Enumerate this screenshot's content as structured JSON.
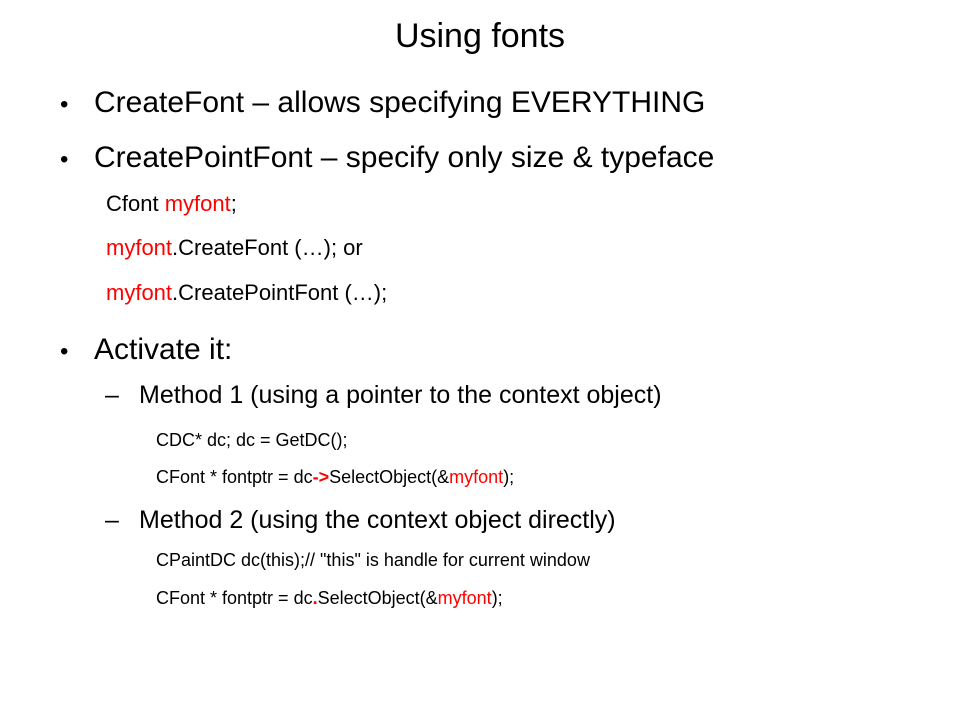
{
  "title": "Using fonts",
  "bullets": [
    {
      "label": "CreateFont – allows specifying EVERYTHING"
    },
    {
      "label": "CreatePointFont – specify only size & typeface"
    },
    {
      "label": "Activate it:"
    }
  ],
  "bullet_glyph": "•",
  "dash_glyph": "–",
  "code_lines": {
    "l1": [
      "Cfont ",
      "myfont",
      ";"
    ],
    "l2": [
      "myfont",
      ".CreateFont (…); or"
    ],
    "l3": [
      "myfont",
      ".CreatePointFont (…);"
    ]
  },
  "methods": [
    {
      "label": "Method 1 (using a pointer to the context object)",
      "lines": [
        [
          "CDC* dc; dc = GetDC();"
        ],
        [
          "CFont * fontptr = dc",
          "->",
          "SelectObject(&",
          "myfont",
          ");"
        ]
      ]
    },
    {
      "label": "Method 2 (using the context object directly)",
      "lines": [
        [
          "CPaintDC  dc(this);//  \"this\" is handle for current window"
        ],
        [
          "CFont * fontptr = dc",
          ".",
          "SelectObject(&",
          "myfont",
          ");"
        ]
      ]
    }
  ],
  "colors": {
    "text": "#000000",
    "accent": "#ff0000",
    "background": "#ffffff"
  }
}
